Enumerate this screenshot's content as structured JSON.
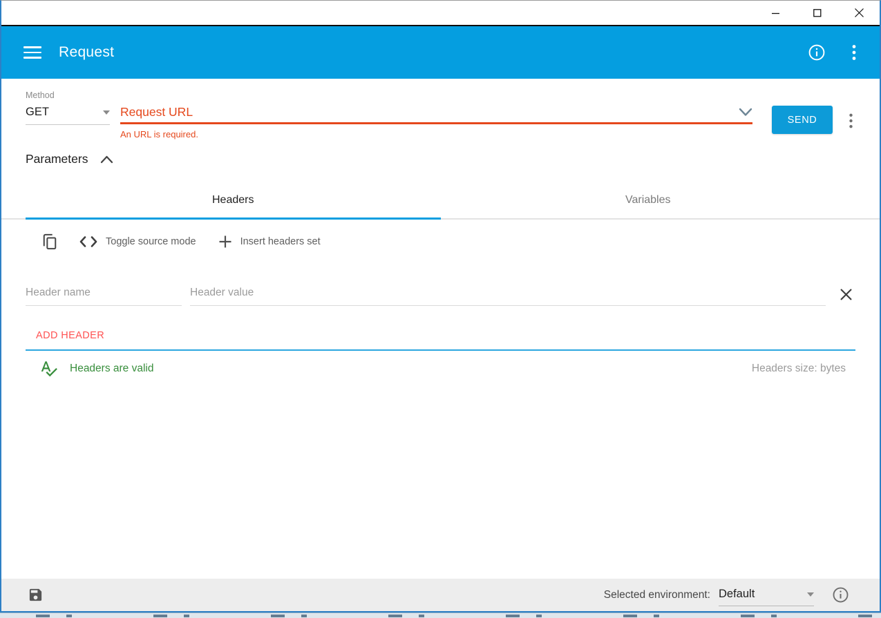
{
  "appbar": {
    "title": "Request"
  },
  "request": {
    "method_label": "Method",
    "method_value": "GET",
    "url_placeholder": "Request URL",
    "url_error": "An URL is required.",
    "send_label": "SEND"
  },
  "parameters": {
    "title": "Parameters"
  },
  "tabs": [
    {
      "label": "Headers"
    },
    {
      "label": "Variables"
    }
  ],
  "toolbar": {
    "toggle_source_label": "Toggle source mode",
    "insert_headers_label": "Insert headers set"
  },
  "header_form": {
    "name_placeholder": "Header name",
    "value_placeholder": "Header value",
    "add_header_label": "ADD HEADER"
  },
  "status": {
    "valid_message": "Headers are valid",
    "size_label": "Headers size: bytes"
  },
  "footer": {
    "environment_label": "Selected environment:",
    "environment_value": "Default"
  },
  "colors": {
    "accent_blue": "#059EE0",
    "error_red": "#E5481C",
    "add_header_red": "#FF5252",
    "valid_green": "#388E3C"
  }
}
